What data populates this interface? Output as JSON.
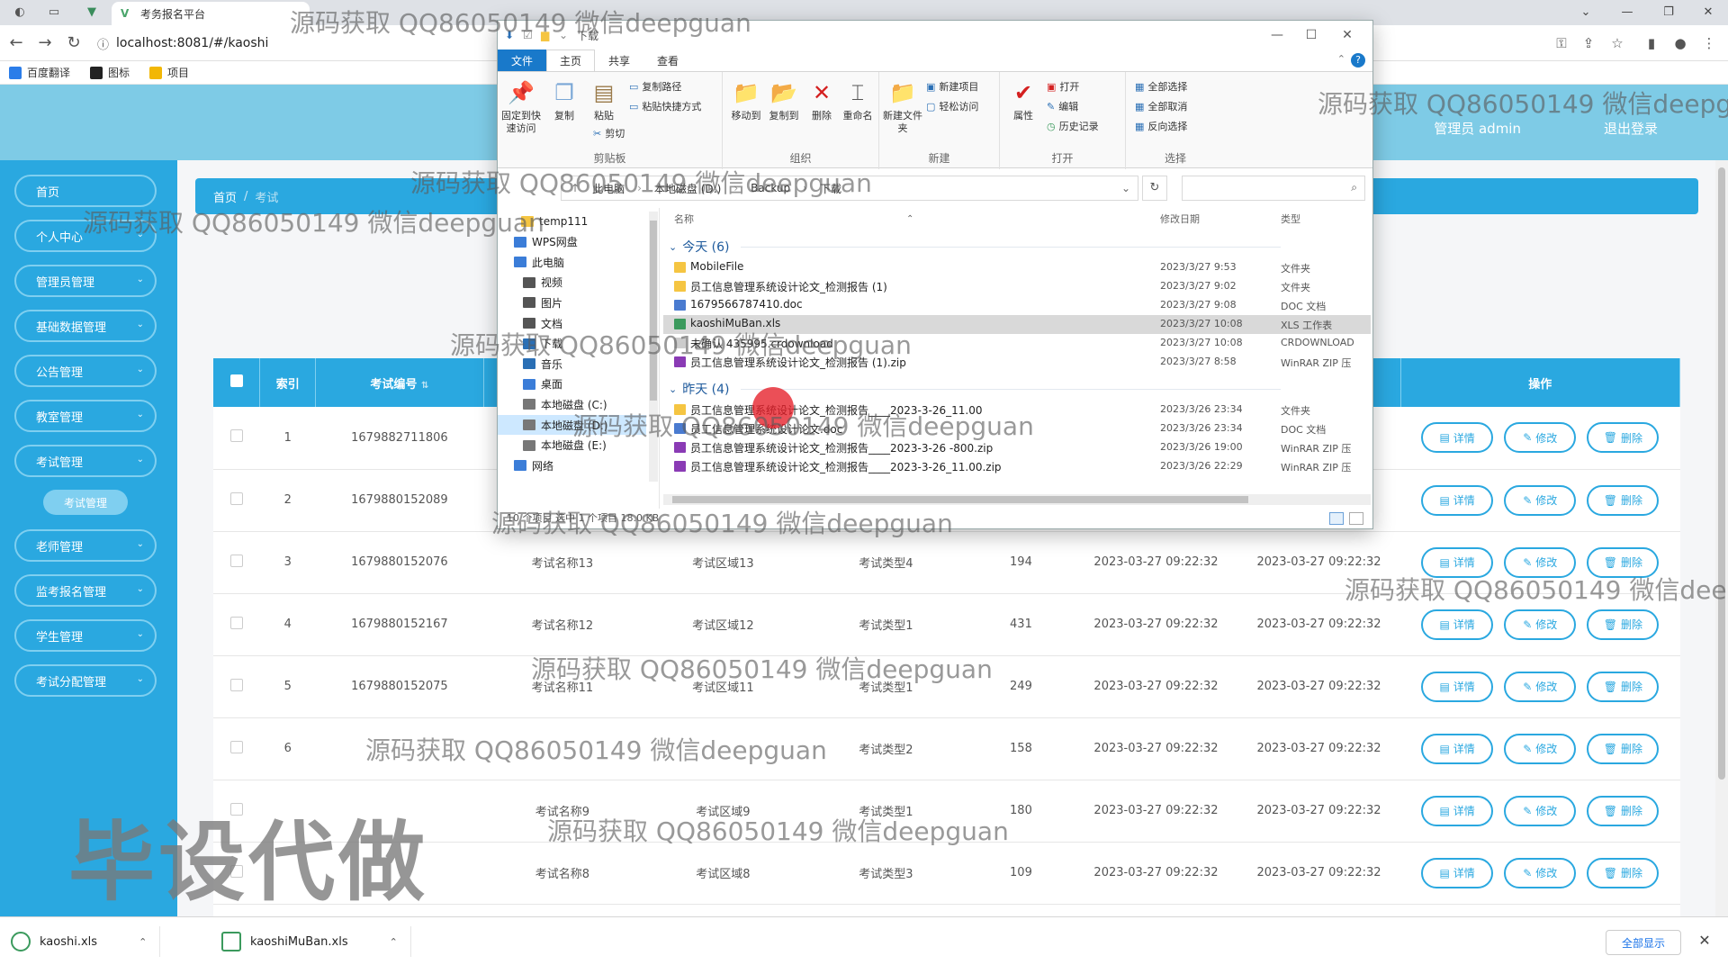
{
  "browser": {
    "tab_title": "考务报名平台",
    "url": "localhost:8081/#/kaoshi",
    "bookmarks": [
      {
        "label": "百度翻译",
        "color": "#2b7de9"
      },
      {
        "label": "图标",
        "color": "#222222"
      },
      {
        "label": "项目",
        "color": "#f2b705"
      }
    ]
  },
  "header": {
    "user_label": "管理员 admin",
    "logout": "退出登录"
  },
  "sidebar": {
    "items": [
      "首页",
      "个人中心",
      "管理员管理",
      "基础数据管理",
      "公告管理",
      "教室管理",
      "考试管理",
      "老师管理",
      "监考报名管理",
      "学生管理",
      "考试分配管理"
    ],
    "sub_item": "考试管理"
  },
  "breadcrumb": {
    "home": "首页",
    "separator": "/",
    "current": "考试"
  },
  "table": {
    "headers": {
      "index": "索引",
      "exam_no": "考试编号",
      "ops": "操作"
    },
    "rows": [
      {
        "idx": "1",
        "no": "1679882711806",
        "name": "",
        "area": "",
        "type": "",
        "count": "",
        "t1": "",
        "t2": ""
      },
      {
        "idx": "2",
        "no": "1679880152089",
        "name": "",
        "area": "",
        "type": "",
        "count": "",
        "t1": "",
        "t2": ""
      },
      {
        "idx": "3",
        "no": "1679880152076",
        "name": "考试名称13",
        "area": "考试区域13",
        "type": "考试类型4",
        "count": "194",
        "t1": "2023-03-27 09:22:32",
        "t2": "2023-03-27 09:22:32"
      },
      {
        "idx": "4",
        "no": "1679880152167",
        "name": "考试名称12",
        "area": "考试区域12",
        "type": "考试类型1",
        "count": "431",
        "t1": "2023-03-27 09:22:32",
        "t2": "2023-03-27 09:22:32"
      },
      {
        "idx": "5",
        "no": "1679880152075",
        "name": "考试名称11",
        "area": "考试区域11",
        "type": "考试类型1",
        "count": "249",
        "t1": "2023-03-27 09:22:32",
        "t2": "2023-03-27 09:22:32"
      },
      {
        "idx": "6",
        "no": "",
        "name": "",
        "area": "",
        "type": "考试类型2",
        "count": "158",
        "t1": "2023-03-27 09:22:32",
        "t2": "2023-03-27 09:22:32"
      },
      {
        "idx": "",
        "no": "",
        "name": "考试名称9",
        "area": "考试区域9",
        "type": "考试类型1",
        "count": "180",
        "t1": "2023-03-27 09:22:32",
        "t2": "2023-03-27 09:22:32"
      },
      {
        "idx": "",
        "no": "",
        "name": "考试名称8",
        "area": "考试区域8",
        "type": "考试类型3",
        "count": "109",
        "t1": "2023-03-27 09:22:32",
        "t2": "2023-03-27 09:22:32"
      }
    ],
    "btn_detail": "详情",
    "btn_edit": "修改",
    "btn_delete": "删除"
  },
  "explorer": {
    "title": "下载",
    "tabs": [
      "文件",
      "主页",
      "共享",
      "查看"
    ],
    "ribbon": {
      "pin": "固定到快速访问",
      "copy": "复制",
      "paste": "粘贴",
      "copy_path": "复制路径",
      "paste_shortcut": "粘贴快捷方式",
      "cut": "剪切",
      "clipboard": "剪贴板",
      "move_to": "移动到",
      "copy_to": "复制到",
      "delete": "删除",
      "rename": "重命名",
      "organize": "组织",
      "new_folder": "新建文件夹",
      "new_item": "新建项目",
      "easy_access": "轻松访问",
      "new": "新建",
      "properties": "属性",
      "open": "打开",
      "edit": "编辑",
      "history": "历史记录",
      "open_group": "打开",
      "select_all": "全部选择",
      "select_none": "全部取消",
      "invert": "反向选择",
      "select": "选择"
    },
    "address": [
      "此电脑",
      "本地磁盘 (D:)",
      "Backup",
      "下载"
    ],
    "nav": [
      "temp111",
      "WPS网盘",
      "此电脑",
      "视频",
      "图片",
      "文档",
      "下载",
      "音乐",
      "桌面",
      "本地磁盘 (C:)",
      "本地磁盘 (D:)",
      "本地磁盘 (E:)",
      "网络"
    ],
    "columns": {
      "name": "名称",
      "date": "修改日期",
      "type": "类型"
    },
    "groups": {
      "today": "今天 (6)",
      "yesterday": "昨天 (4)"
    },
    "today_files": [
      {
        "name": "MobileFile",
        "date": "2023/3/27 9:53",
        "type": "文件夹",
        "color": "#f5c542"
      },
      {
        "name": "员工信息管理系统设计论文_检测报告 (1)",
        "date": "2023/3/27 9:02",
        "type": "文件夹",
        "color": "#f5c542"
      },
      {
        "name": "1679566787410.doc",
        "date": "2023/3/27 9:08",
        "type": "DOC 文档",
        "color": "#4a7bd0"
      },
      {
        "name": "kaoshiMuBan.xls",
        "date": "2023/3/27 10:08",
        "type": "XLS 工作表",
        "color": "#3b9a5d"
      },
      {
        "name": "未确认 435995.crdownload",
        "date": "2023/3/27 10:08",
        "type": "CRDOWNLOAD",
        "color": "#cccccc"
      },
      {
        "name": "员工信息管理系统设计论文_检测报告 (1).zip",
        "date": "2023/3/27 8:58",
        "type": "WinRAR ZIP 压",
        "color": "#8a3bb5"
      }
    ],
    "yesterday_files": [
      {
        "name": "员工信息管理系统设计论文_检测报告____2023-3-26_11.00",
        "date": "2023/3/26 23:34",
        "type": "文件夹",
        "color": "#f5c542"
      },
      {
        "name": "员工信息管理系统设计论文.doc",
        "date": "2023/3/26 23:34",
        "type": "DOC 文档",
        "color": "#4a7bd0"
      },
      {
        "name": "员工信息管理系统设计论文_检测报告____2023-3-26 -800.zip",
        "date": "2023/3/26 19:00",
        "type": "WinRAR ZIP 压",
        "color": "#8a3bb5"
      },
      {
        "name": "员工信息管理系统设计论文_检测报告____2023-3-26_11.00.zip",
        "date": "2023/3/26 22:29",
        "type": "WinRAR ZIP 压",
        "color": "#8a3bb5"
      }
    ],
    "status": "10 个项目    选中 1 个项目  18.0 KB"
  },
  "downloads": [
    {
      "name": "kaoshi.xls"
    },
    {
      "name": "kaoshiMuBan.xls"
    }
  ],
  "downloads_show_all": "全部显示",
  "watermark": "源码获取 QQ86050149 微信deepguan",
  "watermark_big": "毕设代做"
}
